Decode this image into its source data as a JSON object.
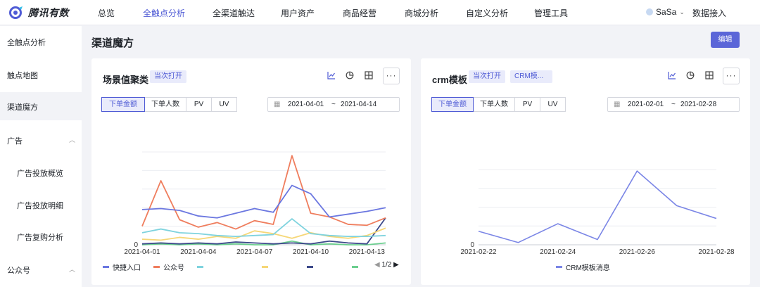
{
  "app": {
    "name": "腾讯有数"
  },
  "nav": {
    "items": [
      "总览",
      "全触点分析",
      "全渠道触达",
      "用户资产",
      "商品经营",
      "商城分析",
      "自定义分析",
      "管理工具"
    ],
    "active_index": 1,
    "user": "SaSa",
    "connect": "数据接入"
  },
  "sidebar": {
    "items": [
      "全触点分析",
      "触点地图",
      "渠道魔方",
      "广告",
      "广告投放概览",
      "广告投放明细",
      "广告复购分析",
      "公众号"
    ],
    "active_index": 2
  },
  "page": {
    "title": "渠道魔方",
    "edit_label": "编辑"
  },
  "cards": [
    {
      "title": "场景值聚类",
      "tags": [
        "当次打开"
      ],
      "metrics": [
        "下单金额",
        "下单人数",
        "PV",
        "UV"
      ],
      "active_metric": 0,
      "date_from": "2021-04-01",
      "date_sep": "~",
      "date_to": "2021-04-14",
      "more": "···",
      "pager": "1/2"
    },
    {
      "title": "crm模板",
      "tags": [
        "当次打开",
        "CRM模..."
      ],
      "metrics": [
        "下单金额",
        "下单人数",
        "PV",
        "UV"
      ],
      "active_metric": 0,
      "date_from": "2021-02-01",
      "date_sep": "~",
      "date_to": "2021-02-28",
      "more": "···"
    }
  ],
  "icons": [
    "line-chart-icon",
    "pie-chart-icon",
    "table-icon",
    "more-icon",
    "calendar-icon",
    "chevron-down-icon",
    "pager-prev-icon",
    "pager-next-icon"
  ],
  "colors": {
    "accent": "#4f5bd5",
    "primary_button": "#5b66d8"
  },
  "chart_data": [
    {
      "type": "line",
      "x": [
        "2021-04-01",
        "2021-04-02",
        "2021-04-03",
        "2021-04-04",
        "2021-04-05",
        "2021-04-06",
        "2021-04-07",
        "2021-04-08",
        "2021-04-09",
        "2021-04-10",
        "2021-04-11",
        "2021-04-12",
        "2021-04-13",
        "2021-04-14"
      ],
      "x_ticks": [
        "2021-04-01",
        "2021-04-04",
        "2021-04-07",
        "2021-04-10",
        "2021-04-13"
      ],
      "y_ticks": [
        "0"
      ],
      "ylim": [
        0,
        100
      ],
      "grid": true,
      "legend_position": "bottom",
      "series": [
        {
          "name": "快捷入口",
          "color": "#6b77e0",
          "values": [
            38,
            39,
            37,
            31,
            29,
            34,
            39,
            35,
            64,
            55,
            30,
            33,
            36,
            40
          ]
        },
        {
          "name": "公众号",
          "color": "#ef7d5d",
          "values": [
            20,
            69,
            27,
            19,
            24,
            17,
            26,
            22,
            96,
            34,
            30,
            22,
            21,
            29
          ]
        },
        {
          "name": "",
          "color": "#7fd3de",
          "values": [
            13,
            17,
            13,
            12,
            10,
            9,
            10,
            11,
            28,
            12,
            10,
            9,
            9,
            10
          ]
        },
        {
          "name": "",
          "color": "#f6d777",
          "values": [
            6,
            5,
            8,
            6,
            9,
            7,
            15,
            12,
            7,
            13,
            9,
            7,
            10,
            18
          ]
        },
        {
          "name": "",
          "color": "#3d4a8a",
          "values": [
            1,
            2,
            1,
            2,
            1,
            3,
            2,
            1,
            2,
            1,
            4,
            2,
            1,
            29
          ]
        },
        {
          "name": "",
          "color": "#6ccf8f",
          "values": [
            0,
            1,
            0,
            1,
            0,
            1,
            0,
            0,
            4,
            0,
            1,
            0,
            0,
            2
          ]
        }
      ]
    },
    {
      "type": "line",
      "x": [
        "2021-02-22",
        "2021-02-23",
        "2021-02-24",
        "2021-02-25",
        "2021-02-26",
        "2021-02-27",
        "2021-02-28"
      ],
      "x_ticks": [
        "2021-02-22",
        "2021-02-24",
        "2021-02-26",
        "2021-02-28"
      ],
      "y_ticks": [
        "0"
      ],
      "ylim": [
        0,
        100
      ],
      "grid": true,
      "legend_position": "bottom",
      "series": [
        {
          "name": "CRM模板消息",
          "color": "#7b86e6",
          "values": [
            18,
            3,
            28,
            7,
            98,
            52,
            35
          ]
        }
      ]
    }
  ]
}
